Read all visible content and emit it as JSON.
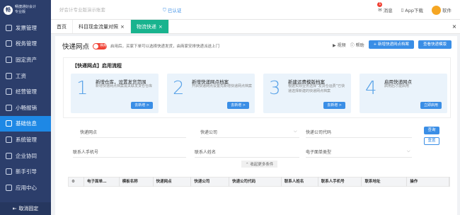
{
  "brand": {
    "logo_char": "畅",
    "name_line1": "畅捷通好会计",
    "name_line2": "专业版"
  },
  "sidebar": {
    "items": [
      {
        "label": "发票管理",
        "icon": "invoice-icon"
      },
      {
        "label": "税务管理",
        "icon": "tax-icon"
      },
      {
        "label": "固定资产",
        "icon": "asset-icon"
      },
      {
        "label": "工资",
        "icon": "salary-icon"
      },
      {
        "label": "经营管理",
        "icon": "business-icon"
      },
      {
        "label": "小畅报销",
        "icon": "reimburse-icon"
      },
      {
        "label": "基础信息",
        "icon": "info-icon"
      },
      {
        "label": "系统管理",
        "icon": "system-icon"
      },
      {
        "label": "企业协同",
        "icon": "collab-icon"
      },
      {
        "label": "新手引导",
        "icon": "guide-icon"
      },
      {
        "label": "应用中心",
        "icon": "app-icon"
      }
    ],
    "active_index": 6,
    "bottom_label": "取消固定"
  },
  "topbar": {
    "search_placeholder": "好会计专业版演示账套",
    "auth_label": "已认证",
    "message_label": "消息",
    "message_count": "1",
    "download_label": "App下载",
    "user_name": "软件"
  },
  "tabs": [
    {
      "label": "首页"
    },
    {
      "label": "科目现金流量对照",
      "closable": true
    },
    {
      "label": "物流快递",
      "closable": true,
      "active": true
    }
  ],
  "page": {
    "title": "快递网点",
    "toggle_label": "停用",
    "hint": "启用后，买家下单可以选择快递发货，由商家安排快递派送上门",
    "video_label": "视频",
    "help_label": "帮助",
    "new_button": "+ 新增快递网点档案",
    "view_button": "查看快递模版"
  },
  "flow": {
    "title": "【快递网点】启用流程",
    "steps": [
      {
        "num": "1",
        "title": "新增仓库，设置发货范围",
        "desc": "新增快递网点档案需关联发货仓仓库",
        "button": "去新增 >"
      },
      {
        "num": "2",
        "title": "新增快递网点档案",
        "desc": "开启快递网点设置先新增快递网点档案",
        "button": "去新增 >"
      },
      {
        "num": "3",
        "title": "新建运费模版档案",
        "desc": "根据实际业务选择“发货仓运费”已快递选择新建的快递网点档案",
        "button": "去新增 >"
      },
      {
        "num": "4",
        "title": "启用快递网点",
        "desc": "启用后才能启用",
        "button": "立即启用"
      }
    ]
  },
  "filters": {
    "site_label": "快递网点",
    "company_label": "快递公司",
    "company_code_label": "快递公司代码",
    "contact_phone_label": "联系人手机号",
    "contact_name_label": "联系人姓名",
    "waybill_type_label": "电子面单类型",
    "search_button": "查询",
    "reset_button": "重置",
    "collapse_label": "收起更多条件"
  },
  "table": {
    "headers": [
      "",
      "电子面单…",
      "模板名称",
      "快递网点",
      "快递公司",
      "快递公司代码",
      "联系人姓名",
      "联系人手机号",
      "联系地址",
      "操作"
    ]
  }
}
